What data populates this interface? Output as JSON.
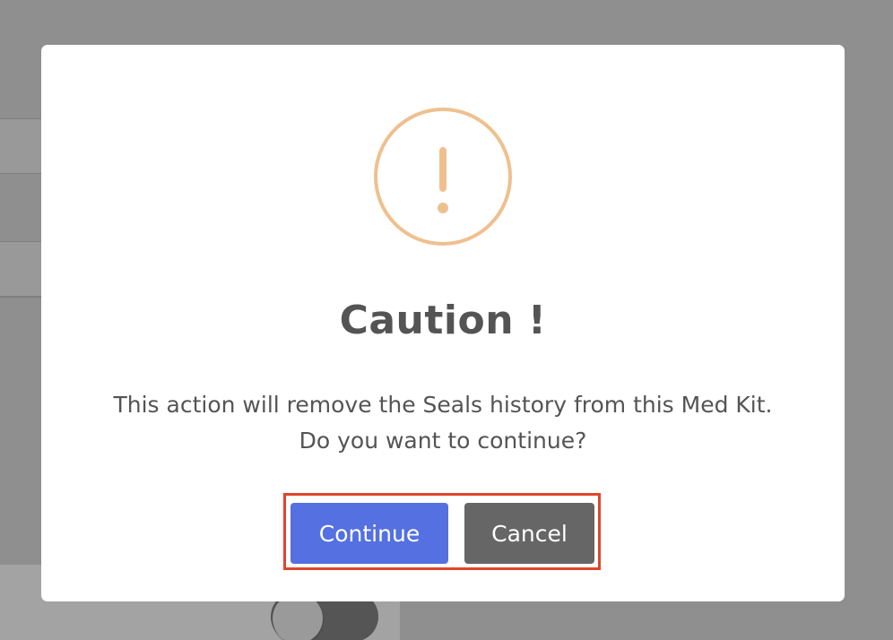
{
  "dialog": {
    "title": "Caution !",
    "message": "This action will remove the Seals history from this Med Kit. Do you want to continue?",
    "icon": "warning-icon",
    "icon_color": "#efc08f",
    "continue_label": "Continue",
    "cancel_label": "Cancel",
    "continue_color": "#5470e1",
    "cancel_color": "#666666",
    "highlight_color": "#e0452c"
  },
  "background": {
    "overlay_color": "#8f8f8f",
    "toggle_state": "off"
  }
}
